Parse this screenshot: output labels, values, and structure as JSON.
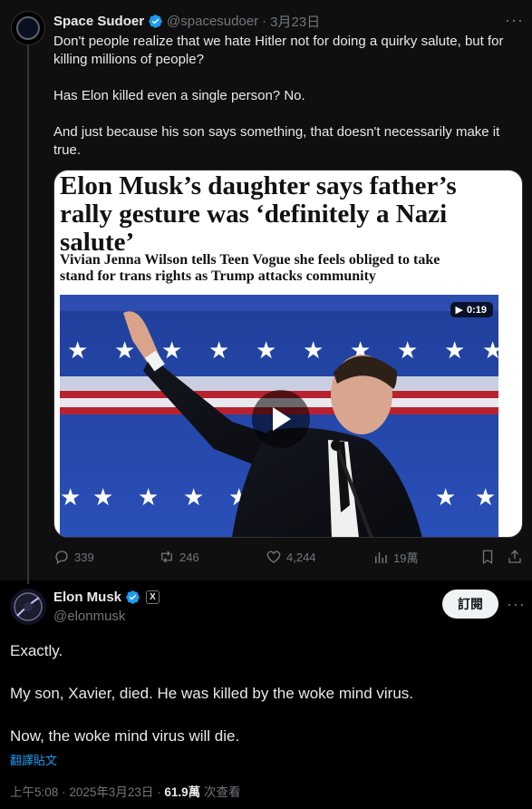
{
  "post1": {
    "author_name": "Space Sudoer",
    "handle": "@spacesudoer",
    "separator": "·",
    "date": "3月23日",
    "paragraphs": [
      "Don't people realize that we hate Hitler not for doing a quirky salute, but for killing millions of people?",
      "Has Elon killed even a single person? No.",
      "And just because his son says something, that doesn't necessarily make it true."
    ],
    "media": {
      "headline": "Elon Musk’s daughter says father’s rally gesture was ‘definitely a Nazi salute’",
      "subhead": "Vivian Jenna Wilson tells Teen Vogue she feels obliged to take stand for trans rights as Trump attacks community",
      "duration": "0:19"
    },
    "actions": {
      "replies": "339",
      "reposts": "246",
      "likes": "4,244",
      "views": "19萬"
    }
  },
  "post2": {
    "author_name": "Elon Musk",
    "handle": "@elonmusk",
    "badge": "X",
    "subscribe_label": "訂閱",
    "paragraphs": [
      "Exactly.",
      "My son, Xavier, died. He was killed by the woke mind virus.",
      "Now, the woke mind virus will die."
    ],
    "translate_label": "翻譯貼文",
    "time": "上午5:08",
    "separator": "·",
    "date": "2025年3月23日",
    "views_count": "61.9萬",
    "views_label": "次查看"
  },
  "colors": {
    "accent": "#1d9bf0",
    "muted": "#71767b",
    "text": "#e7e9ea",
    "background": "#000000"
  }
}
